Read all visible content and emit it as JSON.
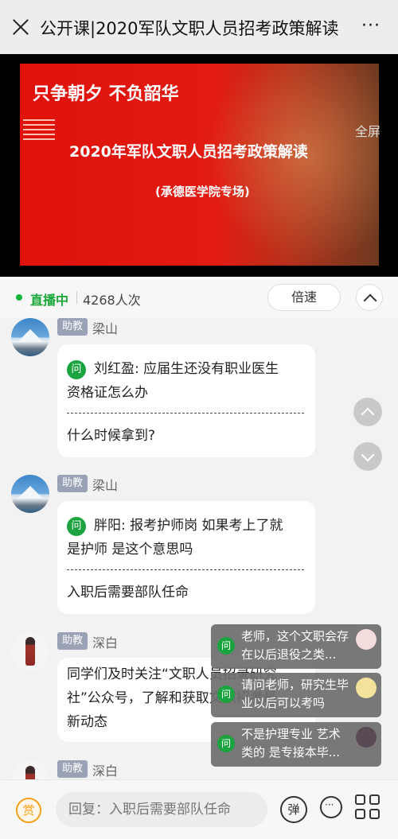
{
  "header": {
    "title": "公开课|2020军队文职人员招考政策解读",
    "more": "···"
  },
  "video": {
    "slogan": "只争朝夕 不负韶华",
    "title": "2020年军队文职人员招考政策解读",
    "subtitle": "(承德医学院专场)",
    "fullscreen": "全屏"
  },
  "status": {
    "live": "直播中",
    "viewers": "4268人次",
    "speed": "倍速"
  },
  "messages": [
    {
      "role": "助教",
      "sender": "梁山",
      "badge": "问",
      "question": [
        "刘红盈: 应届生还没有职业医生",
        "资格证怎么办"
      ],
      "answer": "什么时候拿到?"
    },
    {
      "role": "助教",
      "sender": "梁山",
      "badge": "问",
      "question": [
        "胖阳: 报考护师岗 如果考上了就",
        "是护师 是这个意思吗"
      ],
      "answer": "入职后需要部队任命"
    },
    {
      "role": "助教",
      "sender": "深白",
      "lines": [
        "同学们及时关注“文职人员招录研究",
        "社”公众号，了解和获取文职招考最",
        "新动态"
      ]
    },
    {
      "role": "助教",
      "sender": "深白"
    }
  ],
  "floating_questions": [
    {
      "badge": "问",
      "text": "老师，这个文职会存在以后退役之类..."
    },
    {
      "badge": "问",
      "text": "请问老师，研究生毕业以后可以考吗"
    },
    {
      "badge": "问",
      "text": "不是护理专业 艺术类的 是专接本毕..."
    }
  ],
  "bottom": {
    "reward": "赏",
    "reply_placeholder": "回复：入职后需要部队任命",
    "danmu": "弹"
  },
  "colors": {
    "live_green": "#17a637",
    "tag_gray": "#9aa2b6",
    "question_badge": "#1aa33e",
    "reward_orange": "#f2a01a"
  }
}
